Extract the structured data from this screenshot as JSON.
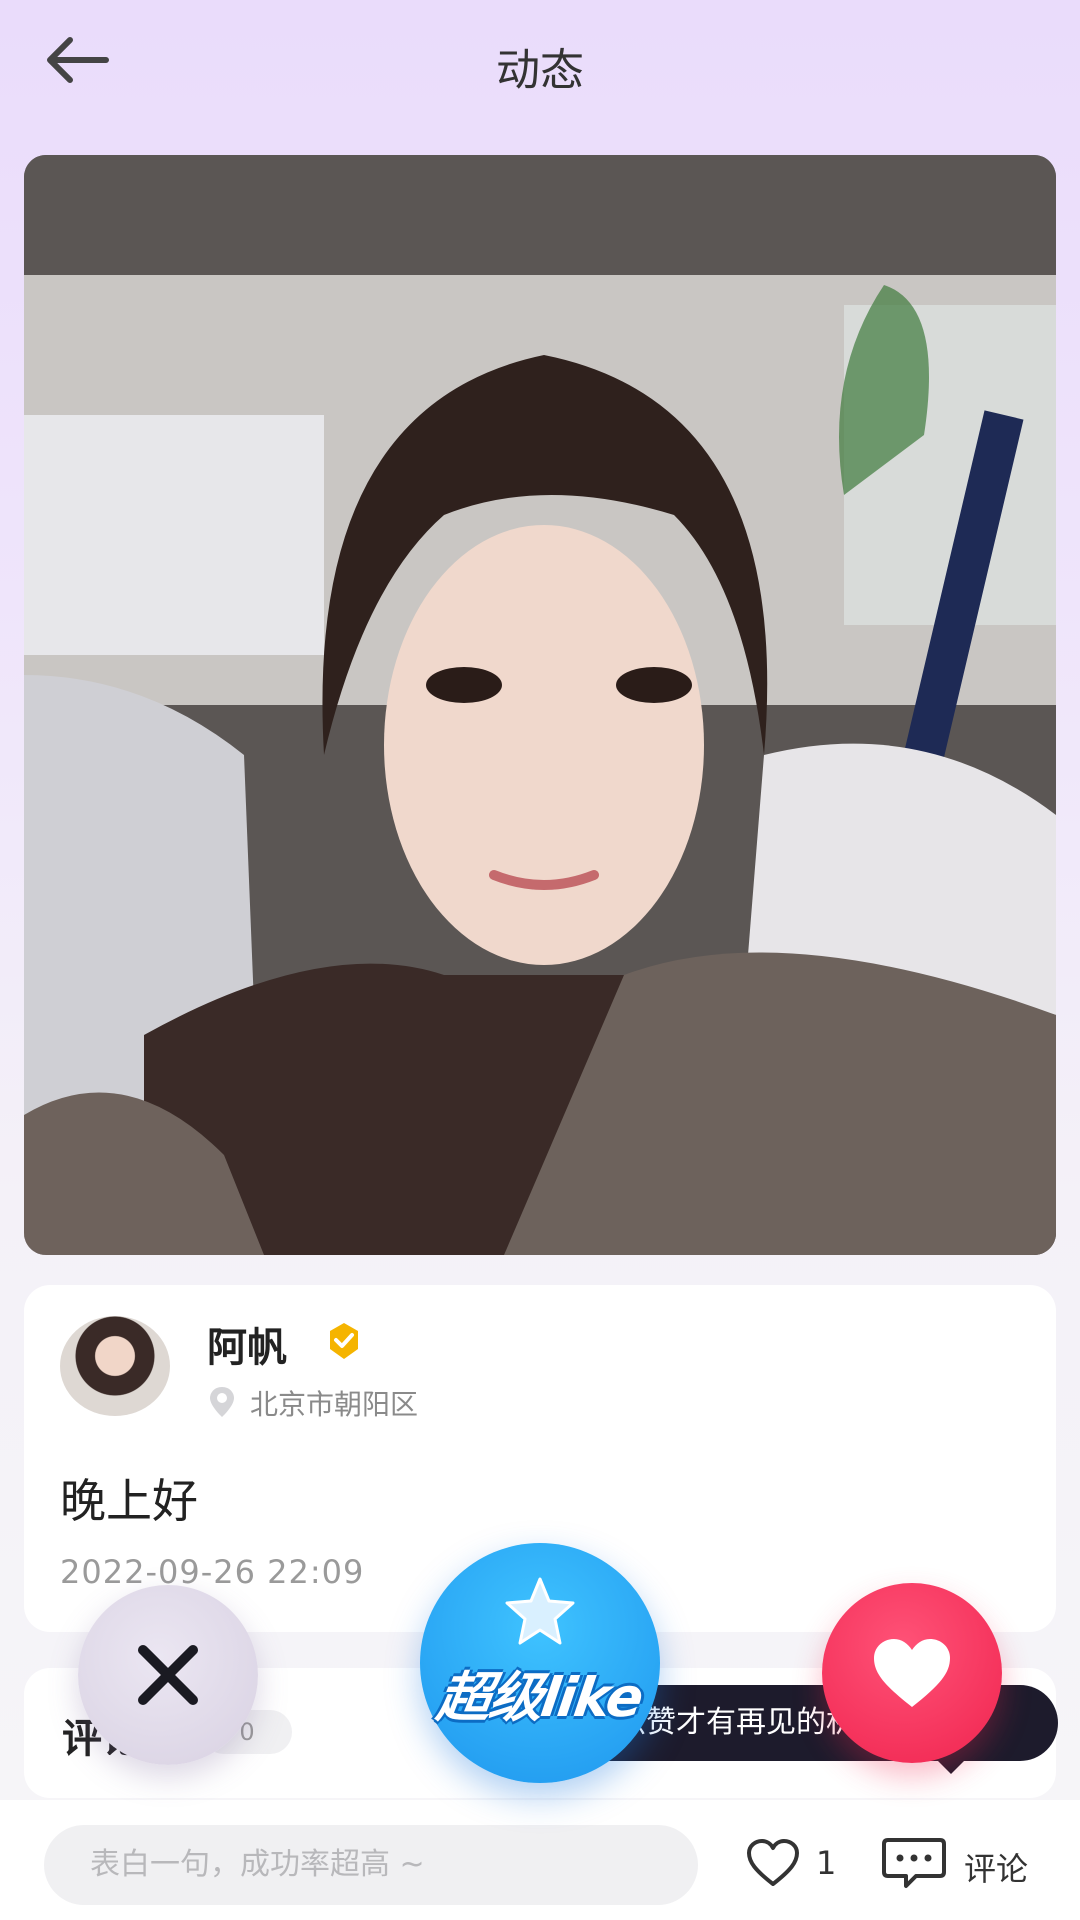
{
  "header": {
    "title": "动态"
  },
  "post": {
    "author_name": "阿帆",
    "location": "北京市朝阳区",
    "text": "晚上好",
    "timestamp": "2022-09-26 22:09"
  },
  "comments": {
    "label": "评论",
    "count": "0"
  },
  "actions": {
    "super_like_label": "超级like",
    "tooltip": "相互点赞才有再见的机会哦~"
  },
  "bottom_bar": {
    "input_placeholder": "表白一句，成功率超高 ~",
    "like_count": "1",
    "comment_label": "评论"
  },
  "colors": {
    "super_like": "#1e96ee",
    "heart": "#f0244f",
    "verified_badge": "#f5b400"
  }
}
